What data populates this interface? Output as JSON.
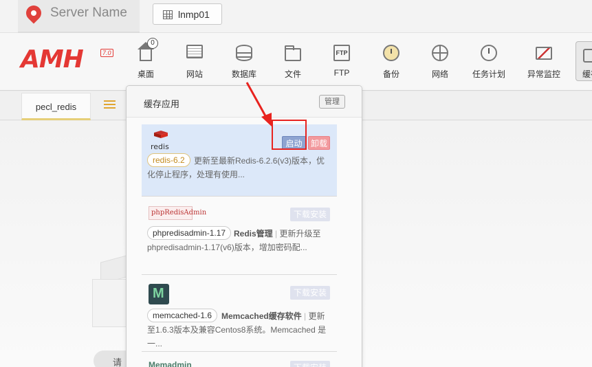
{
  "topbar": {
    "server_name": "Server Name",
    "host_tab": "lnmp01"
  },
  "nav": {
    "logo": "AMH",
    "logo_version": "7.0",
    "items": [
      {
        "label": "桌面",
        "badge": "0",
        "icon": "home-icon"
      },
      {
        "label": "网站",
        "icon": "monitor-icon"
      },
      {
        "label": "数据库",
        "icon": "database-icon"
      },
      {
        "label": "文件",
        "icon": "folder-icon"
      },
      {
        "label": "FTP",
        "icon": "ftp-icon",
        "icon_text": "FTP"
      },
      {
        "label": "备份",
        "icon": "backup-clock-icon"
      },
      {
        "label": "网络",
        "icon": "globe-icon"
      },
      {
        "label": "任务计划",
        "icon": "task-clock-icon"
      },
      {
        "label": "异常监控",
        "icon": "pulse-monitor-icon"
      },
      {
        "label": "缓存",
        "icon": "cache-icon"
      }
    ]
  },
  "subbar": {
    "tab_label": "pecl_redis"
  },
  "popup": {
    "title": "缓存应用",
    "manage_label": "管理",
    "apps": [
      {
        "logo_text": "redis",
        "version": "redis-6.2",
        "description": "更新至最新Redis-6.2.6(v3)版本，优化停止程序，处理有使用...",
        "start_label": "启动",
        "uninstall_label": "卸载"
      },
      {
        "logo_text": "phpRedisAdmin",
        "version": "phpredisadmin-1.17",
        "description_bold": "Redis管理",
        "description": "更新升级至phpredisadmin-1.17(v6)版本，增加密码配...",
        "download_label": "下载安装"
      },
      {
        "logo_text": "M",
        "version": "memcached-1.6",
        "description_bold": "Memcached缓存软件",
        "description": "更新至1.6.3版本及兼容Centos8系统。Memcached 是一...",
        "download_label": "下载安装"
      },
      {
        "logo_text": "Memadmin",
        "download_label": "下载安装"
      }
    ]
  },
  "background_hint": "请",
  "colors": {
    "brand_red": "#e43834",
    "start_blue": "#8ea4d1",
    "uninstall_pink": "#f2999d",
    "active_row": "#dce8f9"
  }
}
